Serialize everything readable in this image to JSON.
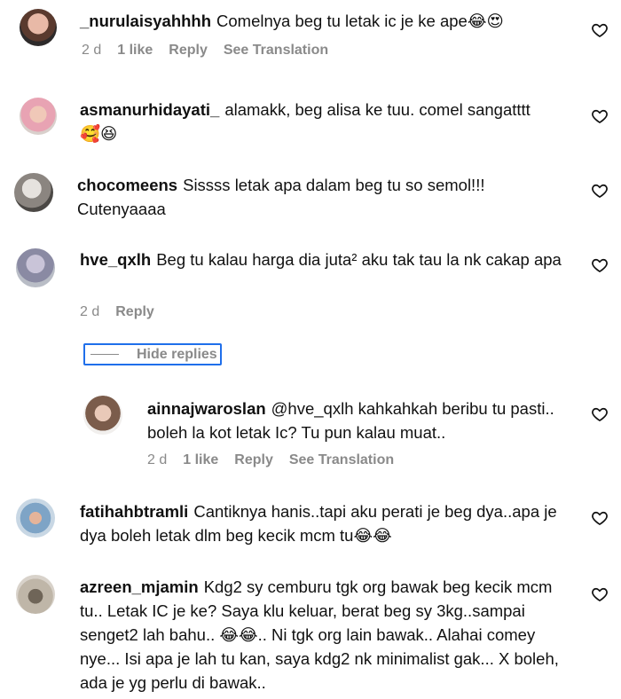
{
  "comments": [
    {
      "user": "_nurulaisyahhhh",
      "text": "Comelnya beg tu letak ic je ke ape😂😍",
      "time": "2 d",
      "likes": "1 like",
      "reply": "Reply",
      "translate": "See Translation"
    },
    {
      "user": "asmanurhidayati_",
      "text": "alamakk, beg alisa ke tuu. comel sangatttt 🥰😆"
    },
    {
      "user": "chocomeens",
      "text": "Sissss letak apa dalam beg tu so semol!!! Cutenyaaaa"
    },
    {
      "user": "hve_qxlh",
      "text": "Beg tu kalau harga dia juta² aku tak tau la nk cakap apa",
      "time": "2 d",
      "reply": "Reply"
    },
    {
      "user": "ainnajwaroslan",
      "text": "@hve_qxlh kahkahkah beribu tu pasti.. boleh la kot letak Ic? Tu pun kalau muat..",
      "time": "2 d",
      "likes": "1 like",
      "reply": "Reply",
      "translate": "See Translation"
    },
    {
      "user": "fatihahbtramli",
      "text": "Cantiknya hanis..tapi aku perati je beg dya..apa je dya boleh letak dlm beg kecik mcm tu😂😂"
    },
    {
      "user": "azreen_mjamin",
      "text": "Kdg2 sy cemburu tgk org bawak beg kecik mcm tu.. Letak IC je ke? Saya klu keluar, berat beg sy 3kg..sampai senget2 lah bahu.. 😂😂.. Ni tgk org lain bawak.. Alahai comey nye... Isi apa je lah tu kan, saya kdg2 nk minimalist gak... X boleh, ada je yg perlu di bawak.."
    }
  ],
  "hide_replies": "Hide replies",
  "colors": {
    "text": "#111111",
    "meta": "#8a8a8a",
    "focus": "#1f6feb"
  }
}
